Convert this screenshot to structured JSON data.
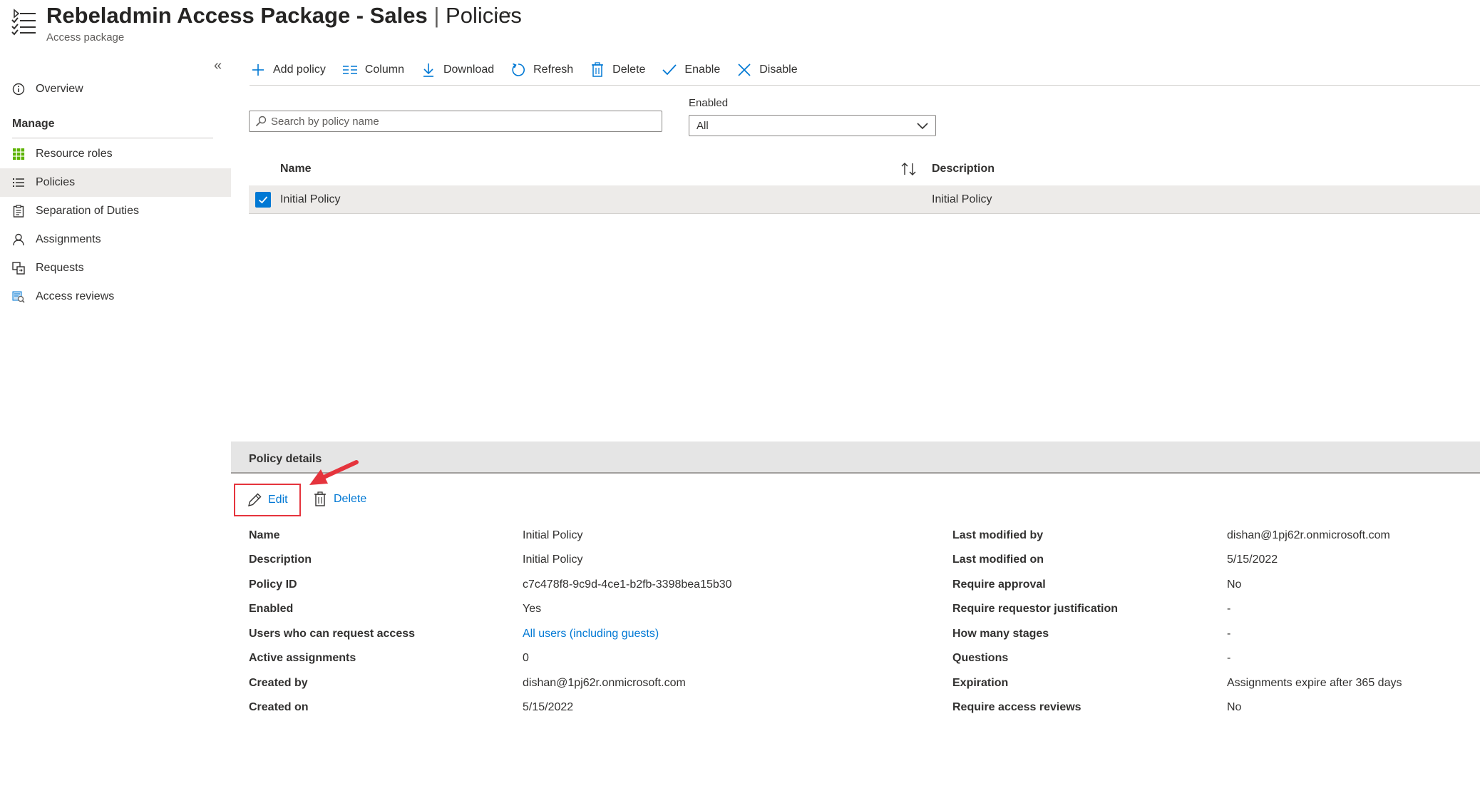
{
  "header": {
    "title_main": "Rebeladmin Access Package - Sales",
    "title_sep": " | ",
    "title_page": "Policies",
    "more": "···",
    "subtitle": "Access package"
  },
  "sidebar": {
    "collapse": "«",
    "overview": "Overview",
    "section": "Manage",
    "items": [
      {
        "label": "Resource roles",
        "icon": "grid-icon"
      },
      {
        "label": "Policies",
        "icon": "list-icon"
      },
      {
        "label": "Separation of Duties",
        "icon": "clipboard-icon"
      },
      {
        "label": "Assignments",
        "icon": "person-icon"
      },
      {
        "label": "Requests",
        "icon": "requests-icon"
      },
      {
        "label": "Access reviews",
        "icon": "review-icon"
      }
    ],
    "selected_index": 1
  },
  "toolbar": {
    "add_policy": "Add policy",
    "column": "Column",
    "download": "Download",
    "refresh": "Refresh",
    "delete": "Delete",
    "enable": "Enable",
    "disable": "Disable"
  },
  "filters": {
    "search_placeholder": "Search by policy name",
    "search_value": "",
    "enabled_label": "Enabled",
    "enabled_value": "All"
  },
  "grid": {
    "columns": {
      "name": "Name",
      "description": "Description"
    },
    "rows": [
      {
        "name": "Initial Policy",
        "description": "Initial Policy",
        "checked": true
      }
    ]
  },
  "details": {
    "title": "Policy details",
    "edit": "Edit",
    "delete": "Delete",
    "left": [
      {
        "label": "Name",
        "value": "Initial Policy"
      },
      {
        "label": "Description",
        "value": "Initial Policy"
      },
      {
        "label": "Policy ID",
        "value": "c7c478f8-9c9d-4ce1-b2fb-3398bea15b30"
      },
      {
        "label": "Enabled",
        "value": "Yes"
      },
      {
        "label": "Users who can request access",
        "value": "All users (including guests)"
      },
      {
        "label": "Active assignments",
        "value": "0"
      },
      {
        "label": "Created by",
        "value": "dishan@1pj62r.onmicrosoft.com"
      },
      {
        "label": "Created on",
        "value": "5/15/2022"
      }
    ],
    "right": [
      {
        "label": "Last modified by",
        "value": "dishan@1pj62r.onmicrosoft.com"
      },
      {
        "label": "Last modified on",
        "value": "5/15/2022"
      },
      {
        "label": "Require approval",
        "value": "No"
      },
      {
        "label": "Require requestor justification",
        "value": "-"
      },
      {
        "label": "How many stages",
        "value": "-"
      },
      {
        "label": "Questions",
        "value": "-"
      },
      {
        "label": "Expiration",
        "value": "Assignments expire after 365 days"
      },
      {
        "label": "Require access reviews",
        "value": "No"
      }
    ]
  },
  "colors": {
    "accent": "#0078d4",
    "highlight": "#e5343d",
    "selected_bg": "#edebe9"
  }
}
